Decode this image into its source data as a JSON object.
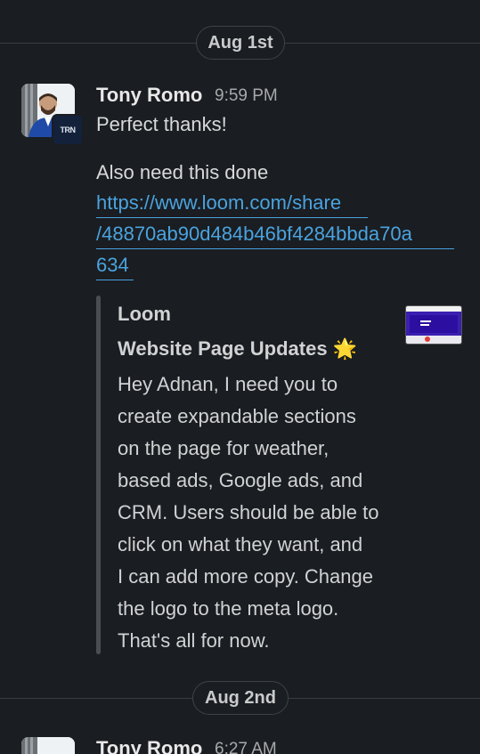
{
  "dividers": [
    {
      "label": "Aug 1st"
    },
    {
      "label": "Aug 2nd"
    }
  ],
  "messages": [
    {
      "sender": "Tony Romo",
      "time": "9:59 PM",
      "avatar_badge": "TRN",
      "lines": [
        "Perfect thanks!",
        "Also need this done"
      ],
      "link": {
        "parts": [
          "https://www.loom.com/share",
          "/48870ab90d484b46bf4284bbda70a",
          "634"
        ]
      },
      "unfurl": {
        "source": "Loom",
        "title": "Website Page Updates",
        "title_emoji": "🌟",
        "body_lines": [
          "Hey Adnan, I need you to",
          "create expandable sections",
          "on the page for weather,",
          "based ads, Google ads, and",
          "CRM. Users should be able to",
          "click on what they want, and",
          "I can add more copy. Change",
          "the logo to the meta logo.",
          "That's all for now."
        ]
      }
    },
    {
      "sender": "Tony Romo",
      "time": "6:27 AM"
    }
  ],
  "colors": {
    "background": "#1a1d21",
    "link": "#4aa3df",
    "thumbnail": "#3a1fb0"
  }
}
